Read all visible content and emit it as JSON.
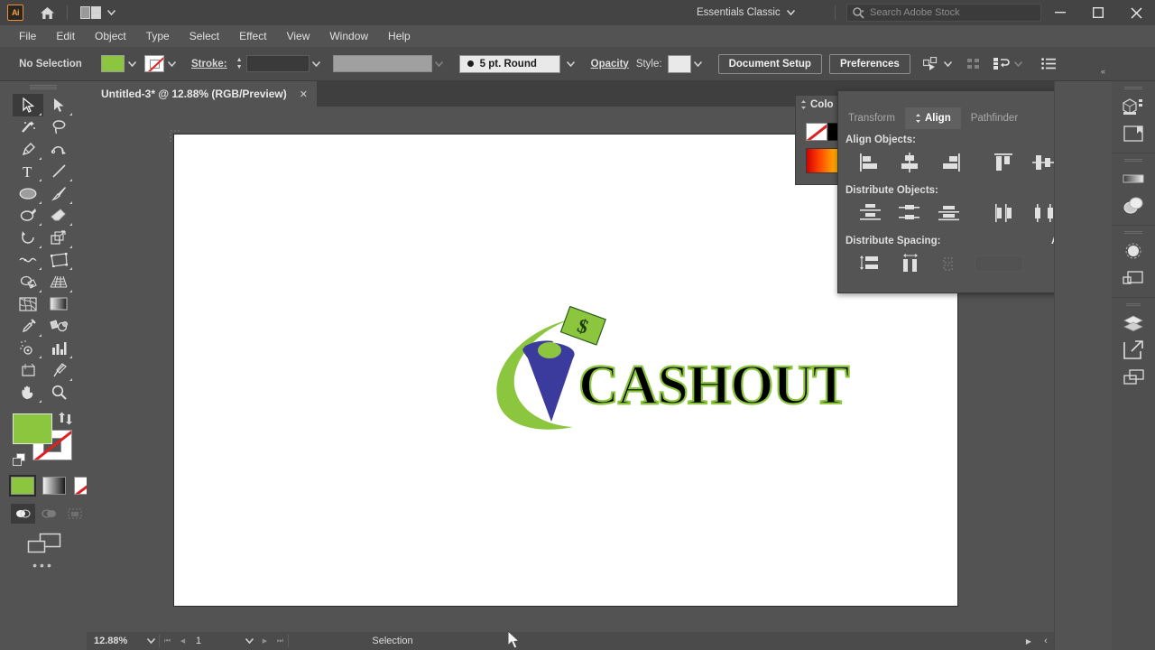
{
  "app": {
    "name": "Adobe Illustrator",
    "badge": "Ai",
    "home_icon": "home-icon",
    "arrange_icon": "arrange-documents-icon",
    "workspace": "Essentials Classic",
    "workspace_caret": "chevron-down-icon",
    "search": {
      "icon": "search-icon",
      "placeholder": "Search Adobe Stock",
      "value": ""
    },
    "window_controls": {
      "minimize": "—",
      "maximize": "☐",
      "close": "✕"
    }
  },
  "menubar": {
    "items": [
      "File",
      "Edit",
      "Object",
      "Type",
      "Select",
      "Effect",
      "View",
      "Window",
      "Help"
    ]
  },
  "controlbar": {
    "selection_state": "No Selection",
    "fill_color": "#8CC63E",
    "fill_caret": "chevron-down-icon",
    "stroke_color": "none",
    "stroke_caret": "chevron-down-icon",
    "stroke_label": "Stroke:",
    "stroke_weight": "",
    "stroke_weight_caret": "chevron-down-icon",
    "variable_width_profile": "",
    "variable_width_caret": "chevron-down-icon",
    "brush_definition": "5 pt. Round",
    "brush_caret": "chevron-down-icon",
    "opacity_label": "Opacity",
    "style_label": "Style:",
    "style_swatch": "#e9e9e9",
    "style_caret": "chevron-down-icon",
    "document_setup": "Document Setup",
    "preferences": "Preferences",
    "select_similar_icon": "select-similar-objects-icon",
    "select_similar_caret": "chevron-down-icon",
    "align_icon": "align-grid-icon",
    "distribute_icon": "distribute-objects-icon",
    "distribute_caret": "chevron-down-icon",
    "panel_options_icon": "list-options-icon"
  },
  "tabstrip": {
    "collapse_icon": "collapse-to-icons-icon",
    "document_tab": {
      "title": "Untitled-3* @ 12.88% (RGB/Preview)",
      "close": "✕"
    }
  },
  "toolbar": {
    "tools": [
      {
        "name": "selection-tool",
        "glyph": "selection",
        "active": true,
        "has_flyout": true
      },
      {
        "name": "direct-selection-tool",
        "glyph": "direct-selection",
        "active": false,
        "has_flyout": true
      },
      {
        "name": "magic-wand-tool",
        "glyph": "magic-wand",
        "active": false,
        "has_flyout": false
      },
      {
        "name": "lasso-tool",
        "glyph": "lasso",
        "active": false,
        "has_flyout": false
      },
      {
        "name": "pen-tool",
        "glyph": "pen",
        "active": false,
        "has_flyout": true
      },
      {
        "name": "curvature-tool",
        "glyph": "curvature",
        "active": false,
        "has_flyout": false
      },
      {
        "name": "type-tool",
        "glyph": "type",
        "active": false,
        "has_flyout": true
      },
      {
        "name": "line-segment-tool",
        "glyph": "line",
        "active": false,
        "has_flyout": true
      },
      {
        "name": "ellipse-tool",
        "glyph": "ellipse",
        "active": false,
        "has_flyout": true
      },
      {
        "name": "paintbrush-tool",
        "glyph": "paintbrush",
        "active": false,
        "has_flyout": true
      },
      {
        "name": "shaper-tool",
        "glyph": "shaper",
        "active": false,
        "has_flyout": true
      },
      {
        "name": "eraser-tool",
        "glyph": "eraser",
        "active": false,
        "has_flyout": true
      },
      {
        "name": "rotate-tool",
        "glyph": "rotate",
        "active": false,
        "has_flyout": true
      },
      {
        "name": "scale-tool",
        "glyph": "scale",
        "active": false,
        "has_flyout": true
      },
      {
        "name": "width-tool",
        "glyph": "width",
        "active": false,
        "has_flyout": true
      },
      {
        "name": "free-transform-tool",
        "glyph": "free-transform",
        "active": false,
        "has_flyout": true
      },
      {
        "name": "shape-builder-tool",
        "glyph": "shape-builder",
        "active": false,
        "has_flyout": true
      },
      {
        "name": "perspective-grid-tool",
        "glyph": "perspective-grid",
        "active": false,
        "has_flyout": true
      },
      {
        "name": "mesh-tool",
        "glyph": "mesh",
        "active": false,
        "has_flyout": false
      },
      {
        "name": "gradient-tool",
        "glyph": "gradient",
        "active": false,
        "has_flyout": false
      },
      {
        "name": "eyedropper-tool",
        "glyph": "eyedropper",
        "active": false,
        "has_flyout": true
      },
      {
        "name": "blend-tool",
        "glyph": "blend",
        "active": false,
        "has_flyout": false
      },
      {
        "name": "symbol-sprayer-tool",
        "glyph": "symbol-sprayer",
        "active": false,
        "has_flyout": true
      },
      {
        "name": "column-graph-tool",
        "glyph": "column-graph",
        "active": false,
        "has_flyout": true
      },
      {
        "name": "artboard-tool",
        "glyph": "artboard",
        "active": false,
        "has_flyout": false
      },
      {
        "name": "slice-tool",
        "glyph": "slice",
        "active": false,
        "has_flyout": true
      },
      {
        "name": "hand-tool",
        "glyph": "hand",
        "active": false,
        "has_flyout": true
      },
      {
        "name": "zoom-tool",
        "glyph": "zoom",
        "active": false,
        "has_flyout": false
      }
    ],
    "fill_swatch": "#8CC63E",
    "stroke_swatch": "none",
    "swap_icon": "swap-fill-stroke-icon",
    "default_icon": "default-fill-stroke-icon",
    "color_modes": [
      {
        "name": "color-mode-button",
        "kind": "color",
        "selected": true
      },
      {
        "name": "gradient-mode-button",
        "kind": "gradient",
        "selected": false
      },
      {
        "name": "none-mode-button",
        "kind": "none",
        "selected": false
      }
    ],
    "draw_modes": [
      {
        "name": "draw-normal-button",
        "active": true
      },
      {
        "name": "draw-behind-button",
        "active": false
      },
      {
        "name": "draw-inside-button",
        "active": false
      }
    ],
    "screen_mode_icon": "change-screen-mode-icon",
    "more_tools": "•••"
  },
  "color_panel": {
    "title": "Colo",
    "grip_icon": "panel-grip-icon",
    "swatches": [
      "none",
      "#000000",
      "#ffffff"
    ],
    "spectrum": "red-to-yellow-spectrum"
  },
  "align_panel": {
    "collapse_icon": "collapse-panel-icon",
    "close_icon": "close-icon",
    "menu_icon": "panel-menu-icon",
    "tabs": [
      {
        "label": "Transform",
        "active": false
      },
      {
        "label": "Align",
        "active": true
      },
      {
        "label": "Pathfinder",
        "active": false
      }
    ],
    "sections": [
      {
        "title": "Align Objects:",
        "buttons": [
          {
            "name": "align-left-edges-button",
            "glyph": "align-left"
          },
          {
            "name": "align-horizontal-center-button",
            "glyph": "align-hcenter"
          },
          {
            "name": "align-right-edges-button",
            "glyph": "align-right"
          },
          {
            "name": "align-top-edges-button",
            "glyph": "align-top"
          },
          {
            "name": "align-vertical-center-button",
            "glyph": "align-vcenter"
          },
          {
            "name": "align-bottom-edges-button",
            "glyph": "align-bottom"
          }
        ]
      },
      {
        "title": "Distribute Objects:",
        "buttons": [
          {
            "name": "distribute-top-edges-button",
            "glyph": "dist-top"
          },
          {
            "name": "distribute-vertical-center-button",
            "glyph": "dist-vcenter"
          },
          {
            "name": "distribute-bottom-edges-button",
            "glyph": "dist-bottom"
          },
          {
            "name": "distribute-left-edges-button",
            "glyph": "dist-left"
          },
          {
            "name": "distribute-horizontal-center-button",
            "glyph": "dist-hcenter"
          },
          {
            "name": "distribute-right-edges-button",
            "glyph": "dist-right"
          }
        ]
      }
    ],
    "spacing_section": {
      "title": "Distribute Spacing:",
      "buttons": [
        {
          "name": "vertical-distribute-spacing-button",
          "glyph": "space-v",
          "disabled": false
        },
        {
          "name": "horizontal-distribute-spacing-button",
          "glyph": "space-h",
          "disabled": false
        },
        {
          "name": "auto-spacing-button",
          "glyph": "auto-space",
          "disabled": true
        }
      ],
      "spacing_value": ""
    },
    "align_to": {
      "label": "Align To:",
      "icon": "align-to-artboard-icon",
      "caret": "chevron-down-icon"
    }
  },
  "right_dock": {
    "collapse_icon": "collapse-to-icons-icon",
    "groups": [
      [
        {
          "name": "dock-libraries-button",
          "glyph": "libraries"
        },
        {
          "name": "dock-artboards-button",
          "glyph": "artboards"
        }
      ],
      [
        {
          "name": "dock-color-button",
          "glyph": "color-ramp"
        },
        {
          "name": "dock-color-guide-button",
          "glyph": "color-guide"
        }
      ],
      [
        {
          "name": "dock-gradient-button",
          "glyph": "gradient-circle"
        },
        {
          "name": "dock-stroke-button",
          "glyph": "stroke-panel"
        }
      ],
      [
        {
          "name": "dock-layers-button",
          "glyph": "layers"
        },
        {
          "name": "dock-export-button",
          "glyph": "export"
        },
        {
          "name": "dock-artboards2-button",
          "glyph": "artboards2"
        }
      ]
    ]
  },
  "canvas": {
    "artboard_label": "",
    "artwork": {
      "name": "cashout-logo",
      "text": "CASHOUT",
      "colors": {
        "swoosh_green": "#8CC63E",
        "figure_blue": "#3B3B9E",
        "head_green": "#8CC63E",
        "bill_green": "#8CC63E",
        "text_fill": "#000000",
        "text_stroke": "#8CC63E",
        "bill_symbol": "$"
      }
    }
  },
  "statusbar": {
    "zoom_level": "12.88%",
    "zoom_caret": "chevron-down-icon",
    "nav_first": "⏮",
    "nav_prev": "◀",
    "page_number": "1",
    "page_caret": "chevron-down-icon",
    "nav_next": "▶",
    "nav_last": "⏭",
    "current_tool": "Selection",
    "play_icon": "▶",
    "resize_icon": "‹"
  },
  "scrollbars": {
    "vertical_thumb_position": "46%",
    "horizontal_thumb_position": "51%"
  }
}
